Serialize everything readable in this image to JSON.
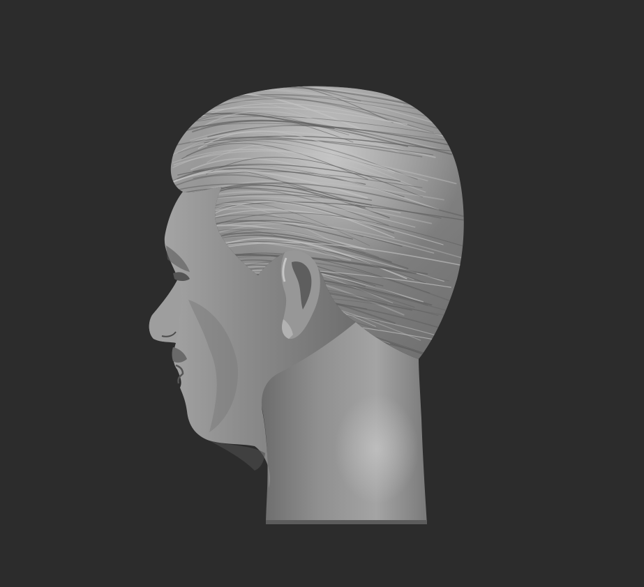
{
  "scene": {
    "subject": "sculpted-head-profile",
    "view": "left-side-profile",
    "material": "matcap-grey-clay",
    "colors": {
      "background": "#2c2c2c",
      "clay_base": "#8e8e8e",
      "clay_light": "#bdbdbd",
      "clay_shadow": "#4a4a4a",
      "hair_base": "#7f7f7f",
      "hair_highlight": "#c4c4c4"
    }
  }
}
